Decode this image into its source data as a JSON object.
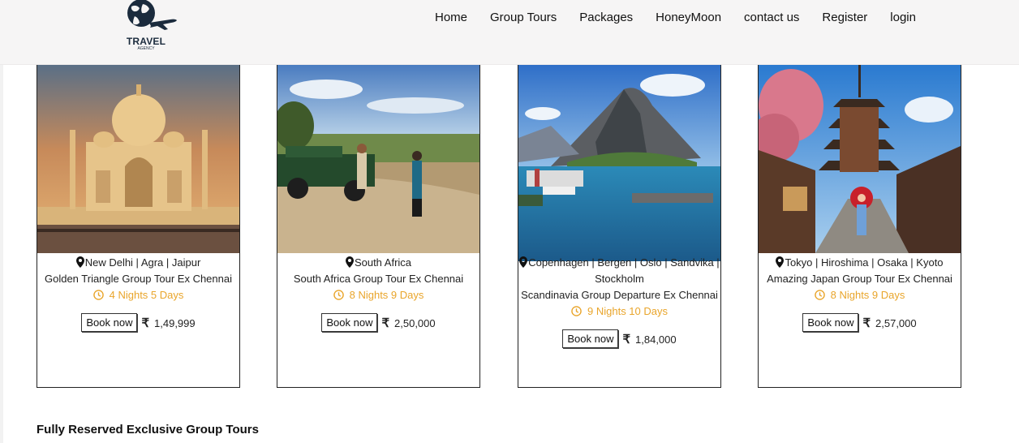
{
  "brand": {
    "name": "TRAVEL",
    "sub": "AGENCY"
  },
  "nav": [
    "Home",
    "Group Tours",
    "Packages",
    "HoneyMoon",
    "contact us",
    "Register",
    "login"
  ],
  "cards": [
    {
      "location": "New Delhi | Agra | Jaipur",
      "title": "Golden Triangle Group Tour Ex Chennai",
      "duration": "4 Nights 5 Days",
      "book": "Book now",
      "currency": "₹",
      "price": "1,49,999",
      "image": "taj-mahal"
    },
    {
      "location": "South Africa",
      "title": "South Africa Group Tour Ex Chennai",
      "duration": "8 Nights 9 Days",
      "book": "Book now",
      "currency": "₹",
      "price": "2,50,000",
      "image": "safari"
    },
    {
      "location": "Copenhagen | Bergen | Oslo | Sandvika |",
      "location2": "Stockholm",
      "title": "Scandinavia Group Departure Ex Chennai",
      "duration": "9 Nights 10 Days",
      "book": "Book now",
      "currency": "₹",
      "price": "1,84,000",
      "image": "fjord"
    },
    {
      "location": "Tokyo | Hiroshima | Osaka | Kyoto",
      "title": "Amazing Japan Group Tour Ex Chennai",
      "duration": "8 Nights 9 Days",
      "book": "Book now",
      "currency": "₹",
      "price": "2,57,000",
      "image": "kyoto-pagoda"
    }
  ],
  "section_title": "Fully Reserved Exclusive Group Tours",
  "colors": {
    "accent": "#e9a52b",
    "navbar": "#f6f5f5"
  }
}
